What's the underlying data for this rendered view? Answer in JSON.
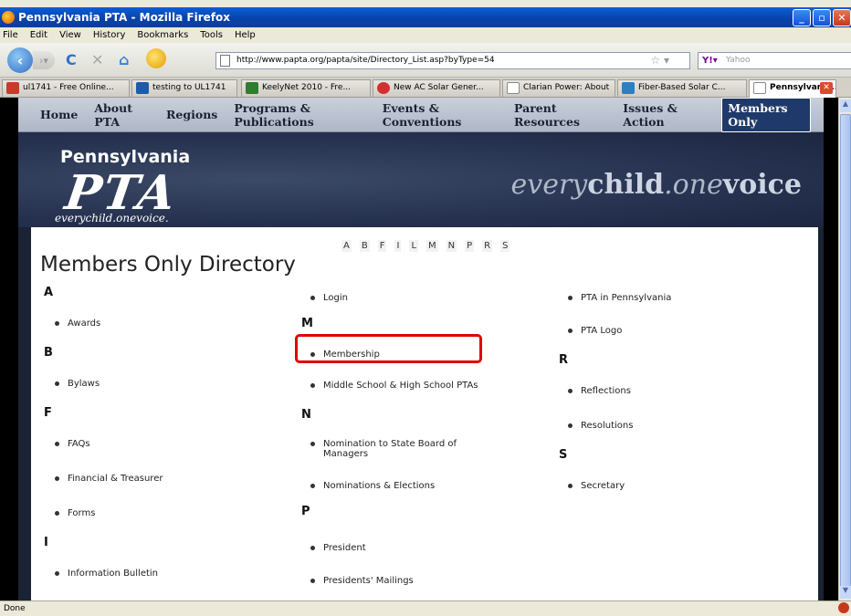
{
  "window": {
    "title": "Pennsylvania PTA - Mozilla Firefox"
  },
  "menu": [
    "File",
    "Edit",
    "View",
    "History",
    "Bookmarks",
    "Tools",
    "Help"
  ],
  "url": "http://www.papta.org/papta/site/Directory_List.asp?byType=54",
  "search_placeholder": "Yahoo",
  "tabs": [
    {
      "label": "ul1741 - Free Online..."
    },
    {
      "label": "testing to UL1741"
    },
    {
      "label": "KeelyNet 2010 - Fre..."
    },
    {
      "label": "New AC Solar Gener..."
    },
    {
      "label": "Clarian Power: About"
    },
    {
      "label": "Fiber-Based Solar C..."
    },
    {
      "label": "Pennsylvania..."
    }
  ],
  "site_nav": [
    "Home",
    "About PTA",
    "Regions",
    "Programs & Publications",
    "Events & Conventions",
    "Parent Resources",
    "Issues & Action",
    "Members Only"
  ],
  "banner": {
    "state": "Pennsylvania",
    "org": "PTA",
    "tagline": "everychild.onevoice.",
    "slogan_every": "every",
    "slogan_child": "child",
    "slogan_dot_one": ".one",
    "slogan_voice": "voice"
  },
  "alpha_index": [
    "A",
    "B",
    "F",
    "I",
    "L",
    "M",
    "N",
    "P",
    "R",
    "S"
  ],
  "directory_title": "Members Only Directory",
  "col1": {
    "A": "A",
    "awards": "Awards",
    "B": "B",
    "bylaws": "Bylaws",
    "F": "F",
    "faqs": "FAQs",
    "financial": "Financial & Treasurer",
    "forms": "Forms",
    "I": "I",
    "info": "Information Bulletin"
  },
  "col2": {
    "login": "Login",
    "M": "M",
    "membership": "Membership",
    "middle": "Middle School & High School PTAs",
    "N": "N",
    "nomination": "Nomination to State Board of Managers",
    "nominations": "Nominations & Elections",
    "P": "P",
    "president": "President",
    "mailings": "Presidents' Mailings"
  },
  "col3": {
    "pta_pa": "PTA in Pennsylvania",
    "pta_logo": "PTA Logo",
    "R": "R",
    "reflections": "Reflections",
    "resolutions": "Resolutions",
    "S": "S",
    "secretary": "Secretary"
  },
  "status": "Done"
}
